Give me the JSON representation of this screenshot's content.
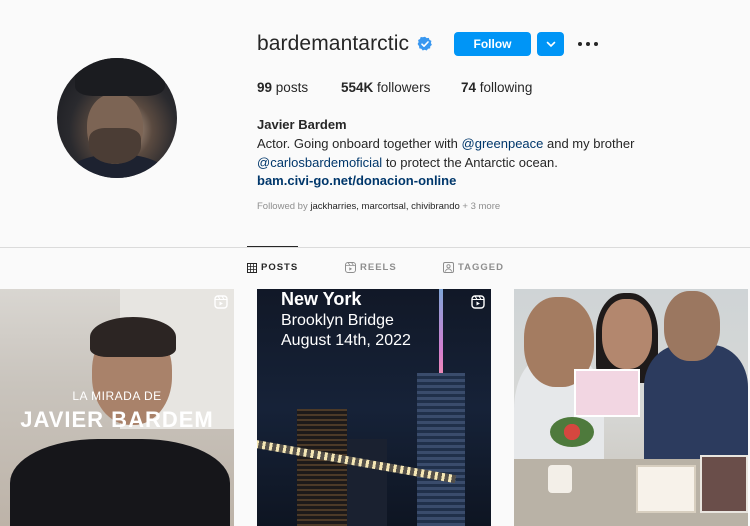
{
  "profile": {
    "username": "bardemantarctic",
    "follow_label": "Follow",
    "stats": {
      "posts_count": "99",
      "posts_label": "posts",
      "followers_count": "554K",
      "followers_label": "followers",
      "following_count": "74",
      "following_label": "following"
    },
    "full_name": "Javier Bardem",
    "bio_line1_prefix": "Actor. Going onboard together with ",
    "bio_mention1": "@greenpeace",
    "bio_line1_suffix": " and my brother",
    "bio_mention2": "@carlosbardemoficial",
    "bio_line2_suffix": " to protect the Antarctic ocean.",
    "link": "bam.civi-go.net/donacion-online",
    "followed_by_prefix": "Followed by ",
    "followed_by_names": "jackharries, marcortsal, chivibrando",
    "followed_by_more": " + 3 more"
  },
  "tabs": [
    {
      "label": "POSTS",
      "icon": "grid-icon",
      "active": true
    },
    {
      "label": "REELS",
      "icon": "reels-icon",
      "active": false
    },
    {
      "label": "TAGGED",
      "icon": "tagged-icon",
      "active": false
    }
  ],
  "posts": [
    {
      "overlay_small": "LA MIRADA DE",
      "overlay_big": "JAVIER BARDEM",
      "type": "reel"
    },
    {
      "line1": "New York",
      "line2": "Brooklyn Bridge",
      "line3": "August 14th, 2022",
      "type": "reel"
    },
    {
      "type": "image"
    }
  ],
  "colors": {
    "primary_button": "#0095f6",
    "link": "#00376b",
    "muted_text": "#8e8e8e",
    "background": "#fafafa"
  }
}
